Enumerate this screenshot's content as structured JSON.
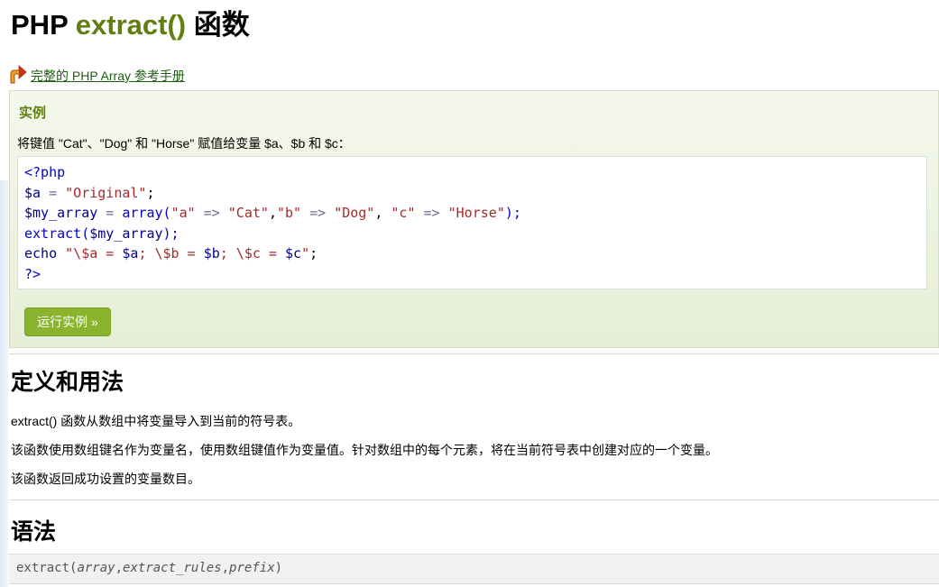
{
  "page": {
    "title_prefix": "PHP ",
    "title_fn": "extract()",
    "title_suffix": " 函数"
  },
  "ref_link": {
    "icon": "return-arrow-icon",
    "label": "完整的 PHP Array 参考手册"
  },
  "example": {
    "heading": "实例",
    "description": "将键值 \"Cat\"、\"Dog\" 和 \"Horse\" 赋值给变量 $a、$b 和 $c：",
    "code": {
      "line1": "<?php",
      "line2_var": "$a",
      "line2_op": " = ",
      "line2_str": "\"Original\"",
      "line2_end": ";",
      "line3_var": "$my_array",
      "line3_op1": " = ",
      "line3_fn": "array(",
      "line3_s1": "\"a\"",
      "line3_arrow1": " => ",
      "line3_s2": "\"Cat\"",
      "line3_c1": ",",
      "line3_s3": "\"b\"",
      "line3_arrow2": " => ",
      "line3_s4": "\"Dog\"",
      "line3_c2": ", ",
      "line3_s5": "\"c\"",
      "line3_arrow3": " => ",
      "line3_s6": "\"Horse\"",
      "line3_end": ");",
      "line4_fn": "extract(",
      "line4_var": "$my_array",
      "line4_end": ");",
      "line5_kw": "echo ",
      "line5_s1": "\"\\$a = ",
      "line5_v1": "$a",
      "line5_s2": "; \\$b = ",
      "line5_v2": "$b",
      "line5_s3": "; \\$c = ",
      "line5_v3": "$c",
      "line5_s4": "\"",
      "line5_end": ";",
      "line6": "?>"
    },
    "run_button": "运行实例 »"
  },
  "definition": {
    "heading": "定义和用法",
    "p1": "extract() 函数从数组中将变量导入到当前的符号表。",
    "p2": "该函数使用数组键名作为变量名，使用数组键值作为变量值。针对数组中的每个元素，将在当前符号表中创建对应的一个变量。",
    "p3": "该函数返回成功设置的变量数目。"
  },
  "syntax": {
    "heading": "语法",
    "fn": "extract(",
    "arg1": "array",
    "sep1": ",",
    "arg2": "extract_rules",
    "sep2": ",",
    "arg3": "prefix",
    "end": ")"
  },
  "colors": {
    "accent_green": "#617f10",
    "button_green": "#8ab42d",
    "link_green": "#1c5f10"
  }
}
